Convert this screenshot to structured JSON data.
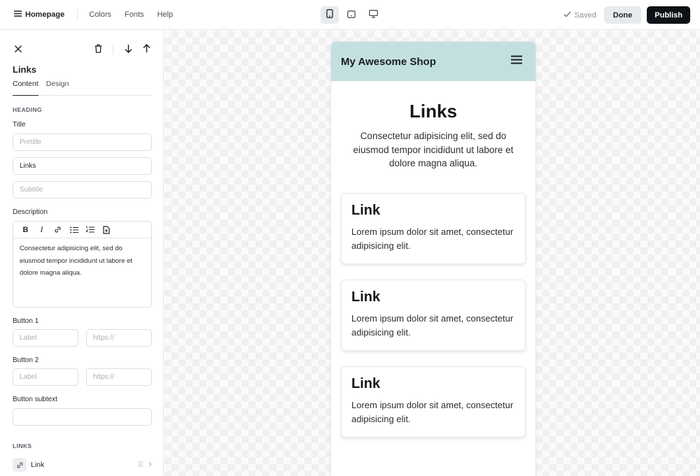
{
  "topbar": {
    "page_menu": "Homepage",
    "nav": [
      "Colors",
      "Fonts",
      "Help"
    ],
    "devices": [
      "mobile-icon",
      "tablet-icon",
      "desktop-icon"
    ],
    "active_device": "mobile",
    "saved_label": "Saved",
    "done_label": "Done",
    "publish_label": "Publish"
  },
  "sidebar": {
    "title": "Links",
    "tabs": [
      "Content",
      "Design"
    ],
    "active_tab": "Content",
    "heading_section": "HEADING",
    "title_label": "Title",
    "pretitle_placeholder": "Pretitle",
    "title_value": "Links",
    "subtitle_placeholder": "Subtitle",
    "description_label": "Description",
    "description_value": "Consectetur adipisicing elit, sed do eiusmod tempor incididunt ut labore et dolore magna aliqua.",
    "button1_label": "Button 1",
    "button2_label": "Button 2",
    "label_placeholder": "Label",
    "url_placeholder": "https://",
    "button_subtext_label": "Button subtext",
    "links_section": "LINKS",
    "link_item": "Link"
  },
  "preview": {
    "logo": "My Awesome Shop",
    "header_color": "#c3e0e1",
    "heading": "Links",
    "description": "Consectetur adipisicing elit, sed do eiusmod tempor incididunt ut labore et dolore magna aliqua.",
    "cards": [
      {
        "title": "Link",
        "text": "Lorem ipsum dolor sit amet, consectetur adipisicing elit."
      },
      {
        "title": "Link",
        "text": "Lorem ipsum dolor sit amet, consectetur adipisicing elit."
      },
      {
        "title": "Link",
        "text": "Lorem ipsum dolor sit amet, consectetur adipisicing elit."
      }
    ]
  }
}
